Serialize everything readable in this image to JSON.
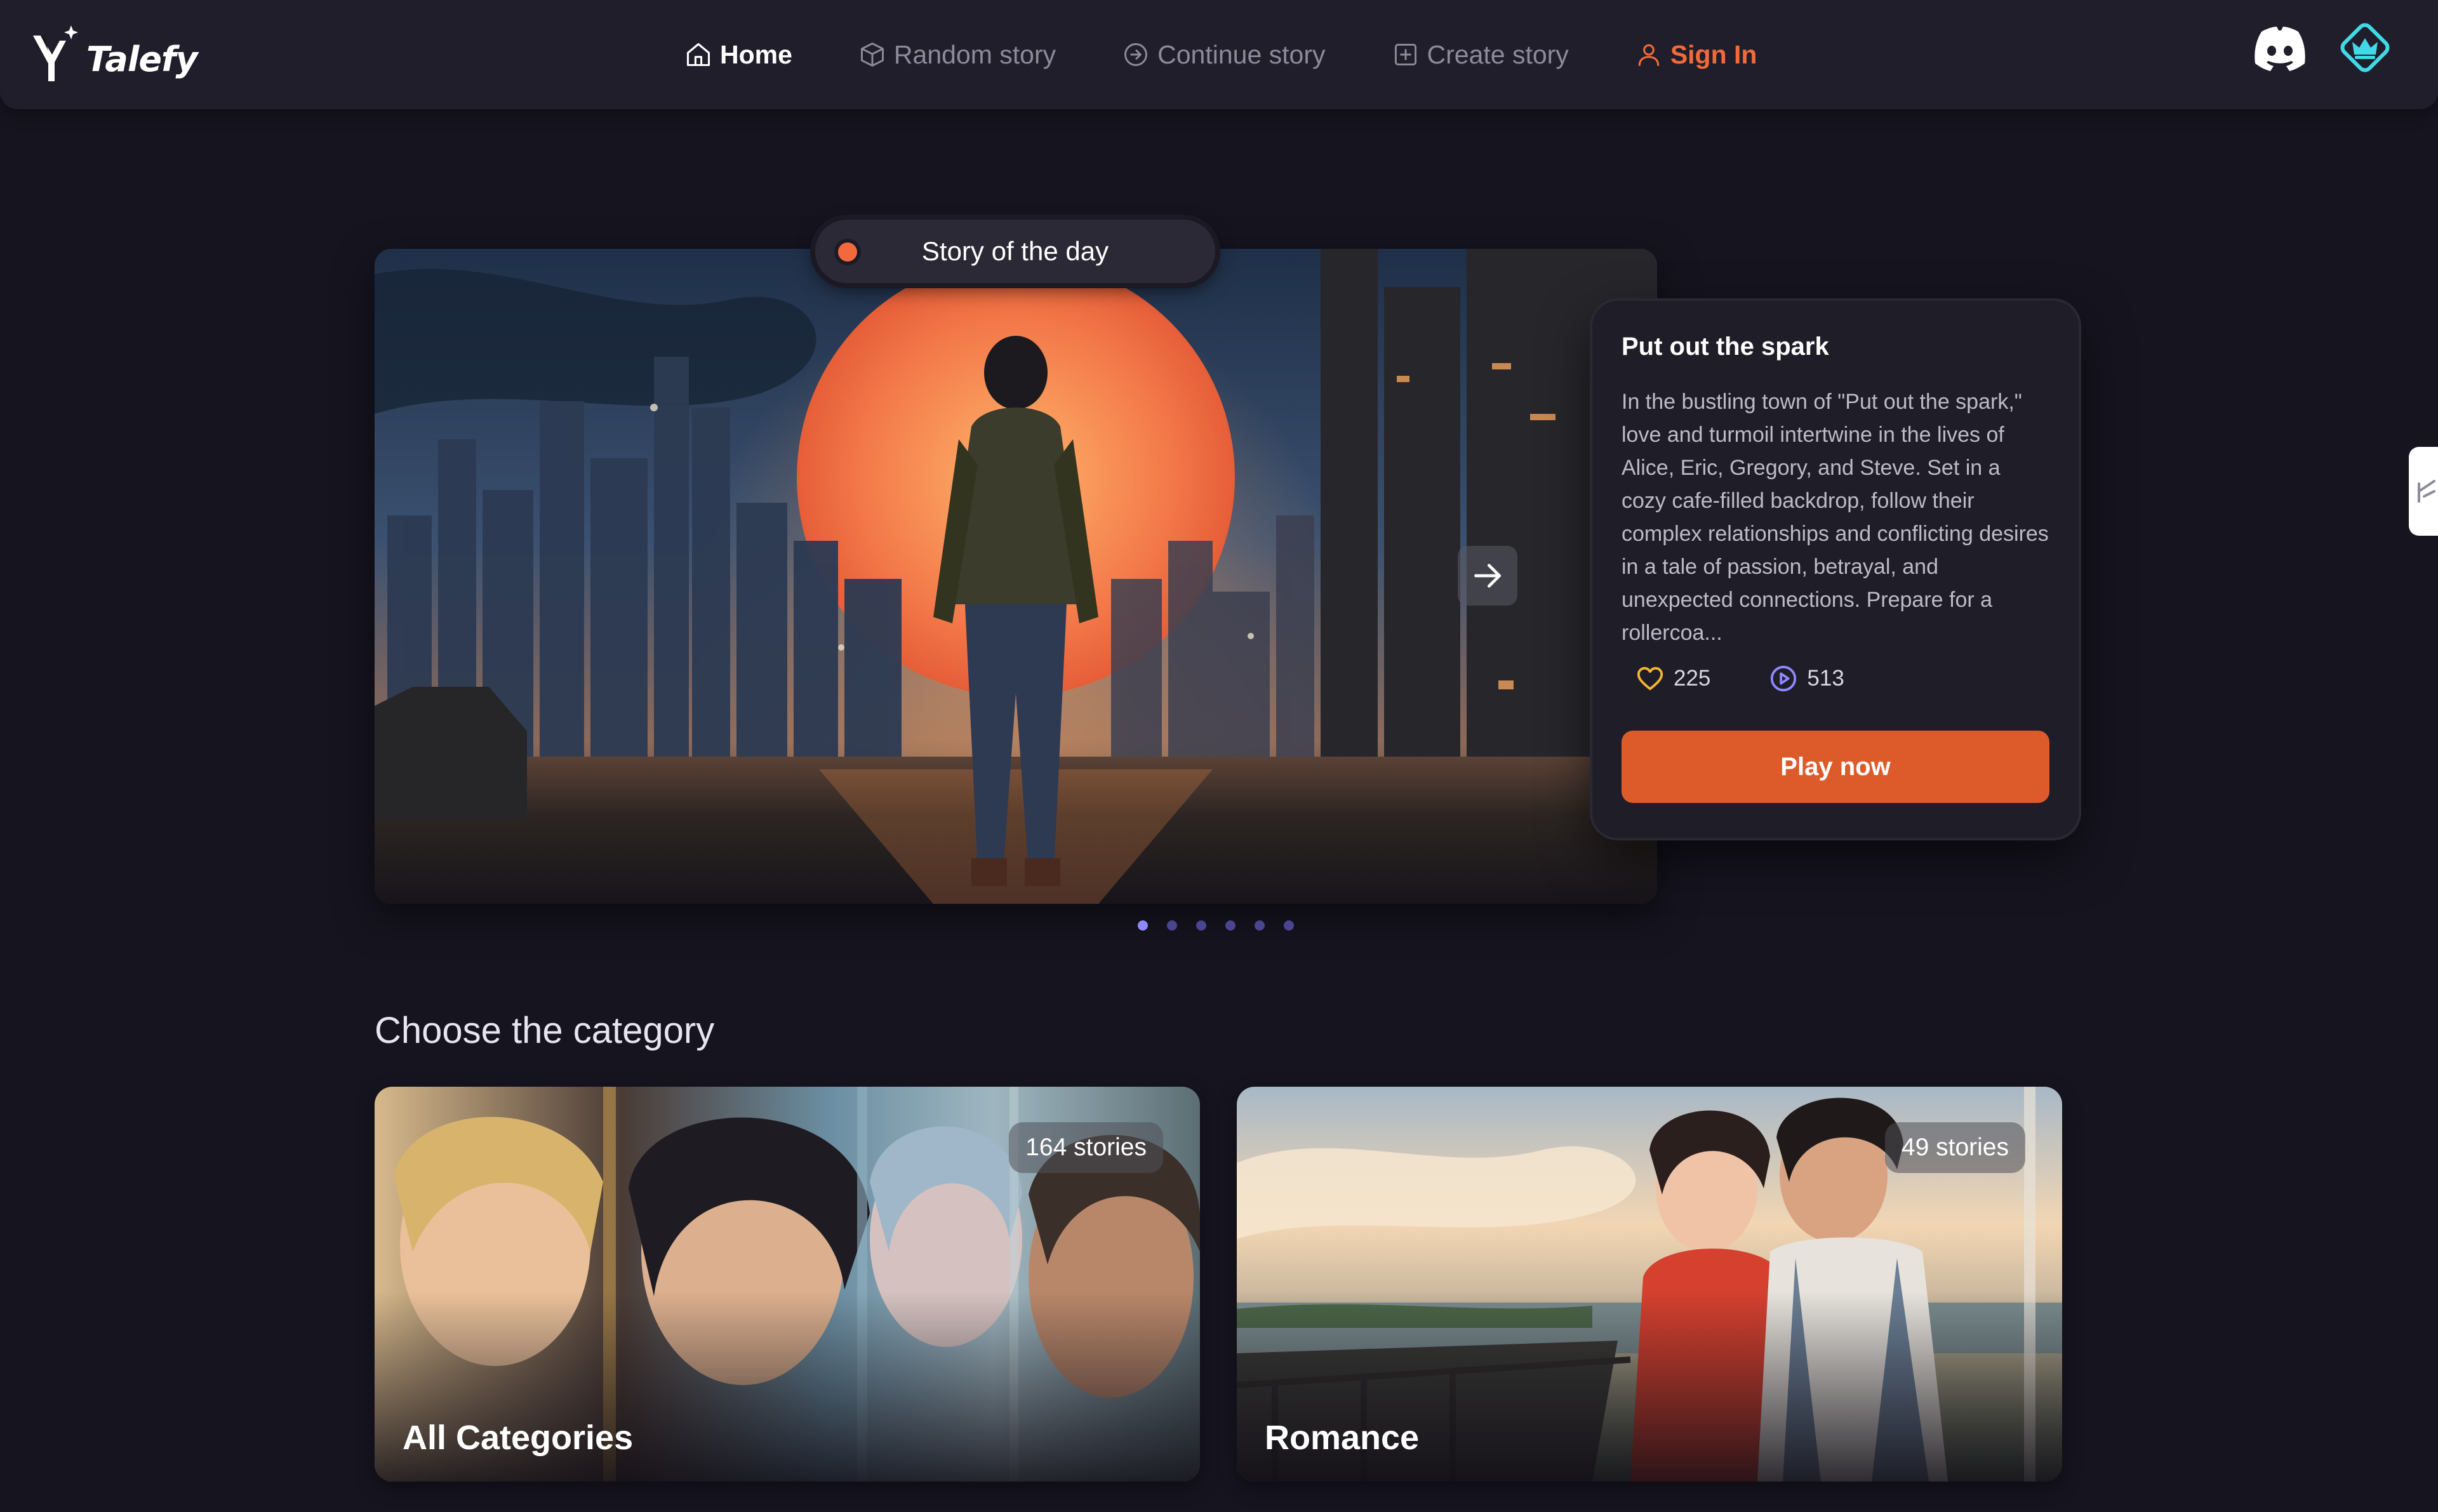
{
  "app": {
    "brand": "Talefy"
  },
  "nav": {
    "items": [
      {
        "label": "Home",
        "icon": "home-icon",
        "active": true
      },
      {
        "label": "Random story",
        "icon": "cube-icon",
        "active": false
      },
      {
        "label": "Continue story",
        "icon": "arrow-circle-icon",
        "active": false
      },
      {
        "label": "Create story",
        "icon": "plus-square-icon",
        "active": false
      }
    ],
    "sign_in": {
      "label": "Sign In",
      "icon": "user-icon"
    },
    "discord_icon": "discord-icon",
    "premium_icon": "crown-diamond-icon"
  },
  "hero": {
    "badge": "Story of the day",
    "story": {
      "title": "Put out the spark",
      "description": "In the bustling town of \"Put out the spark,\" love and turmoil intertwine in the lives of Alice, Eric, Gregory, and Steve. Set in a cozy cafe-filled backdrop, follow their complex relationships and conflicting desires in a tale of passion, betrayal, and unexpected connections. Prepare for a rollercoa...",
      "likes": "225",
      "plays": "513",
      "play_label": "Play now"
    },
    "carousel": {
      "slide_count": 6,
      "active_index": 0
    }
  },
  "categories": {
    "heading": "Choose the category",
    "items": [
      {
        "name": "All Categories",
        "count_label": "164 stories"
      },
      {
        "name": "Romance",
        "count_label": "49 stories"
      }
    ]
  },
  "colors": {
    "background": "#16141f",
    "navbar": "#201e2a",
    "accent_orange": "#f26a3b",
    "play_button": "#dd5b2b",
    "dot_active": "#8f87ff",
    "like_heart": "#f5b731",
    "play_stat": "#8f87ff",
    "premium": "#3fd9e8"
  }
}
